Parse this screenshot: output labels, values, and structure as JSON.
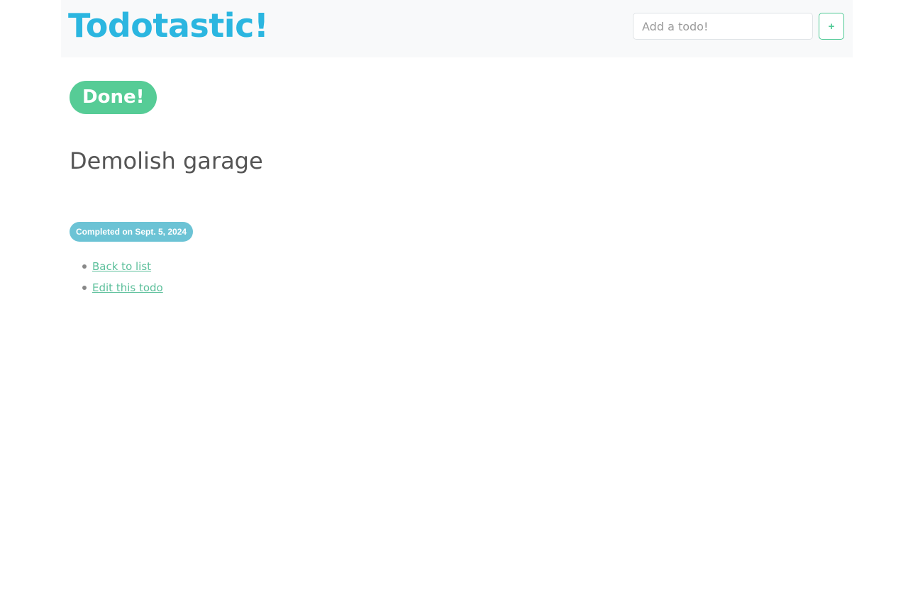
{
  "navbar": {
    "brand": "Todotastic!",
    "add_input_placeholder": "Add a todo!",
    "add_button_label": "+"
  },
  "todo": {
    "status": "Done!",
    "title": "Demolish garage",
    "completed_text": "Completed on Sept. 5, 2024"
  },
  "links": {
    "back": "Back to list",
    "edit": "Edit this todo"
  },
  "colors": {
    "brand": "#2bb6e0",
    "done": "#56cc96",
    "badge": "#6cc3d5",
    "link": "#5bbf9a"
  }
}
